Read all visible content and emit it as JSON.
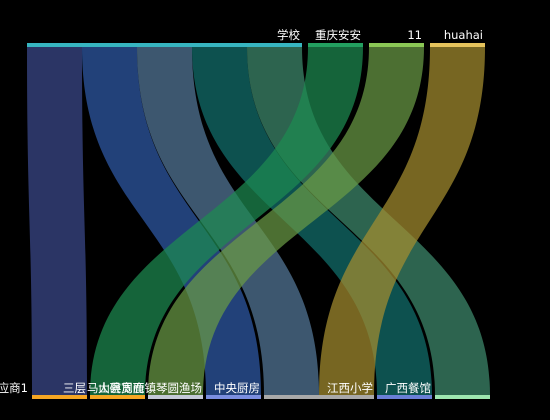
{
  "chart_data": {
    "type": "sankey",
    "title": "",
    "sources": [
      {
        "name": "学校",
        "color": "#37b5c0"
      },
      {
        "name": "重庆安安",
        "color": "#23a060"
      },
      {
        "name": "11",
        "color": "#8bc755"
      },
      {
        "name": "huahai",
        "color": "#e6c35c"
      }
    ],
    "targets": [
      {
        "name": "应商1",
        "color": "#f5a623"
      },
      {
        "name": "三层",
        "color": "#f5a623"
      },
      {
        "name": "大碗宽面",
        "color": "#c4c9d8"
      },
      {
        "name": "马山县周鹿镇琴圆渔场",
        "color": "#7b8ee0"
      },
      {
        "name": "中央厨房",
        "color": "#a9a9a9"
      },
      {
        "name": "江西小学",
        "color": "#6a7fd6"
      },
      {
        "name": "广西餐馆",
        "color": "#9ee6b0"
      }
    ],
    "links": [
      {
        "source": "学校",
        "target": "应商1",
        "value": 1,
        "color": "#3b4a8c"
      },
      {
        "source": "学校",
        "target": "马山县周鹿镇琴圆渔场",
        "value": 1,
        "color": "#2f5aa8"
      },
      {
        "source": "学校",
        "target": "中央厨房",
        "value": 1,
        "color": "#55799a"
      },
      {
        "source": "学校",
        "target": "江西小学",
        "value": 1,
        "color": "#12706e"
      },
      {
        "source": "学校",
        "target": "广西餐馆",
        "value": 1,
        "color": "#3e8a6e"
      },
      {
        "source": "重庆安安",
        "target": "三层",
        "value": 1,
        "color": "#1d8a50"
      },
      {
        "source": "11",
        "target": "大碗宽面",
        "value": 1,
        "color": "#6a9a45"
      },
      {
        "source": "huahai",
        "target": "中央厨房",
        "value": 1,
        "color": "#a58d2f"
      }
    ]
  }
}
